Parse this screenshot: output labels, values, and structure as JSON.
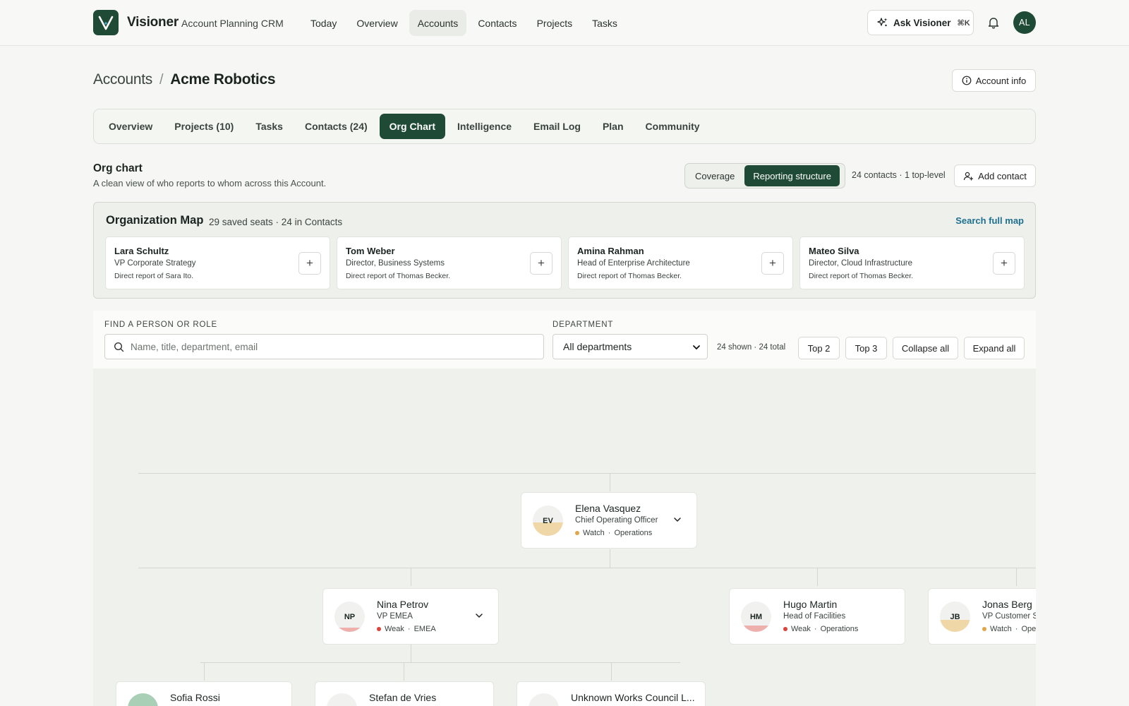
{
  "app": {
    "brand": "Visioner",
    "product": "Account Planning CRM",
    "user_initials": "AL"
  },
  "nav": [
    {
      "label": "Today"
    },
    {
      "label": "Overview"
    },
    {
      "label": "Accounts",
      "active": true
    },
    {
      "label": "Contacts"
    },
    {
      "label": "Projects"
    },
    {
      "label": "Tasks"
    }
  ],
  "ask": {
    "label": "Ask Visioner",
    "shortcut": "⌘K"
  },
  "breadcrumb": {
    "parent": "Accounts",
    "separator": "/",
    "current": "Acme Robotics"
  },
  "account_info_label": "Account info",
  "tabs": [
    {
      "label": "Overview"
    },
    {
      "label": "Projects (10)"
    },
    {
      "label": "Tasks"
    },
    {
      "label": "Contacts (24)"
    },
    {
      "label": "Org Chart",
      "active": true
    },
    {
      "label": "Intelligence"
    },
    {
      "label": "Email Log"
    },
    {
      "label": "Plan"
    },
    {
      "label": "Community"
    }
  ],
  "section": {
    "title": "Org chart",
    "subtitle": "A clean view of who reports to whom across this Account.",
    "view_toggle": [
      {
        "label": "Coverage"
      },
      {
        "label": "Reporting structure",
        "active": true
      }
    ],
    "count": "24 contacts · 1 top-level",
    "add_contact": "Add contact"
  },
  "org_map": {
    "title": "Organization Map",
    "meta": "29 saved seats · 24 in Contacts",
    "link": "Search full map",
    "seats": [
      {
        "name": "Lara Schultz",
        "title": "VP Corporate Strategy",
        "reports": "Direct report of Sara Ito."
      },
      {
        "name": "Tom Weber",
        "title": "Director, Business Systems",
        "reports": "Direct report of Thomas Becker."
      },
      {
        "name": "Amina Rahman",
        "title": "Head of Enterprise Architecture",
        "reports": "Direct report of Thomas Becker."
      },
      {
        "name": "Mateo Silva",
        "title": "Director, Cloud Infrastructure",
        "reports": "Direct report of Thomas Becker."
      }
    ]
  },
  "filters": {
    "find_label": "FIND A PERSON OR ROLE",
    "search_placeholder": "Name, title, department, email",
    "dept_label": "DEPARTMENT",
    "dept_value": "All departments",
    "shown": "24 shown · 24 total",
    "buttons": [
      "Top 2",
      "Top 3",
      "Collapse all",
      "Expand all"
    ]
  },
  "status_colors": {
    "Watch": "#e2a64a",
    "Weak": "#d9443f"
  },
  "chart": {
    "nodes": [
      {
        "initials": "EV",
        "name": "Elena Vasquez",
        "role": "Chief Operating Officer",
        "status": "Watch",
        "dept": "Operations",
        "expandable": true
      },
      {
        "initials": "NP",
        "name": "Nina Petrov",
        "role": "VP EMEA",
        "status": "Weak",
        "dept": "EMEA",
        "expandable": true
      },
      {
        "initials": "HM",
        "name": "Hugo Martin",
        "role": "Head of Facilities",
        "status": "Weak",
        "dept": "Operations"
      },
      {
        "initials": "JB",
        "name": "Jonas Berg",
        "role": "VP Customer Success",
        "status": "Watch",
        "dept": "Operations"
      },
      {
        "initials": "",
        "name": "Sofia Rossi",
        "role": "",
        "status": "",
        "dept": ""
      },
      {
        "initials": "",
        "name": "Stefan de Vries",
        "role": "",
        "status": "",
        "dept": ""
      },
      {
        "initials": "",
        "name": "Unknown Works Council L...",
        "role": "",
        "status": "",
        "dept": ""
      }
    ]
  }
}
